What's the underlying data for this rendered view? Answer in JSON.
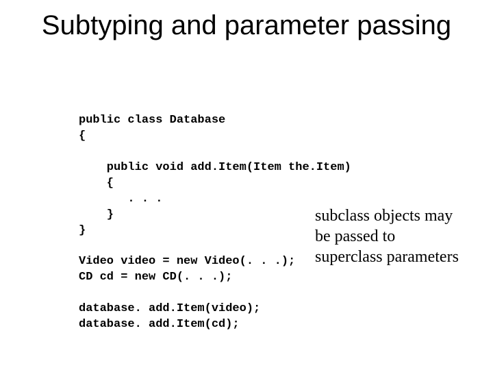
{
  "title": "Subtyping and parameter passing",
  "code": {
    "l1": "public class Database",
    "l2": "{",
    "l3": "    public void add.Item(Item the.Item)",
    "l4": "    {",
    "l5": "       . . .",
    "l6": "    }",
    "l7": "}",
    "l8": "Video video = new Video(. . .);",
    "l9": "CD cd = new CD(. . .);",
    "l10": "database. add.Item(video);",
    "l11": "database. add.Item(cd);"
  },
  "note": "subclass objects may be passed to superclass parameters"
}
